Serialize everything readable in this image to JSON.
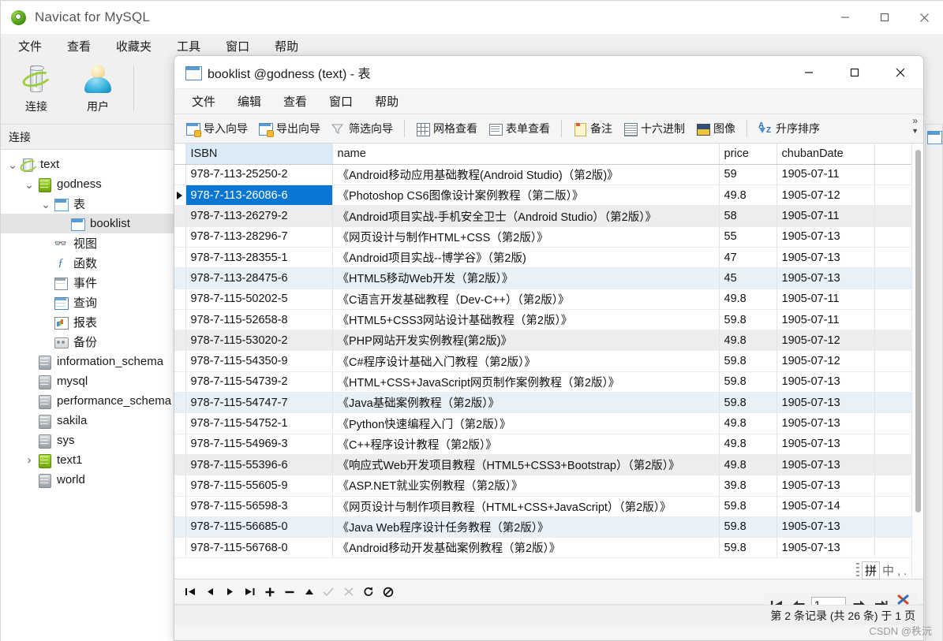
{
  "main_window": {
    "title": "Navicat for MySQL",
    "title_icon": "navicat-logo-icon",
    "menus": [
      "文件",
      "查看",
      "收藏夹",
      "工具",
      "窗口",
      "帮助"
    ],
    "toolbar": [
      {
        "label": "连接",
        "icon": "database-connection-icon"
      },
      {
        "label": "用户",
        "icon": "user-icon"
      }
    ],
    "window_controls": {
      "minimize": "minimize-icon",
      "maximize": "maximize-icon",
      "close": "close-icon"
    },
    "left_panel": {
      "header": "连接",
      "tree": [
        {
          "label": "text",
          "indent": 0,
          "chevron": "down",
          "icon": "connection-icon",
          "selected": false
        },
        {
          "label": "godness",
          "indent": 1,
          "chevron": "down",
          "icon": "database-icon",
          "selected": false
        },
        {
          "label": "表",
          "indent": 2,
          "chevron": "down",
          "icon": "table-folder-icon",
          "selected": false
        },
        {
          "label": "booklist",
          "indent": 3,
          "chevron": "none",
          "icon": "table-icon",
          "selected": true
        },
        {
          "label": "视图",
          "indent": 2,
          "chevron": "none",
          "icon": "view-icon",
          "selected": false
        },
        {
          "label": "函数",
          "indent": 2,
          "chevron": "none",
          "icon": "function-icon",
          "selected": false
        },
        {
          "label": "事件",
          "indent": 2,
          "chevron": "none",
          "icon": "event-icon",
          "selected": false
        },
        {
          "label": "查询",
          "indent": 2,
          "chevron": "none",
          "icon": "query-icon",
          "selected": false
        },
        {
          "label": "报表",
          "indent": 2,
          "chevron": "none",
          "icon": "report-icon",
          "selected": false
        },
        {
          "label": "备份",
          "indent": 2,
          "chevron": "none",
          "icon": "backup-icon",
          "selected": false
        },
        {
          "label": "information_schema",
          "indent": 1,
          "chevron": "none",
          "icon": "database-gray-icon",
          "selected": false
        },
        {
          "label": "mysql",
          "indent": 1,
          "chevron": "none",
          "icon": "database-gray-icon",
          "selected": false
        },
        {
          "label": "performance_schema",
          "indent": 1,
          "chevron": "none",
          "icon": "database-gray-icon",
          "selected": false
        },
        {
          "label": "sakila",
          "indent": 1,
          "chevron": "none",
          "icon": "database-gray-icon",
          "selected": false
        },
        {
          "label": "sys",
          "indent": 1,
          "chevron": "none",
          "icon": "database-gray-icon",
          "selected": false
        },
        {
          "label": "text1",
          "indent": 1,
          "chevron": "right",
          "icon": "database-icon",
          "selected": false
        },
        {
          "label": "world",
          "indent": 1,
          "chevron": "none",
          "icon": "database-gray-icon",
          "selected": false
        }
      ]
    }
  },
  "child_window": {
    "title": "booklist @godness (text) - 表",
    "title_icon": "table-icon",
    "window_controls": {
      "minimize": "minimize-icon",
      "maximize": "maximize-icon",
      "close": "close-icon"
    },
    "menus": [
      "文件",
      "编辑",
      "查看",
      "窗口",
      "帮助"
    ],
    "toolbar": [
      {
        "label": "导入向导",
        "icon": "import-wizard-icon"
      },
      {
        "label": "导出向导",
        "icon": "export-wizard-icon"
      },
      {
        "label": "筛选向导",
        "icon": "filter-wizard-icon"
      },
      {
        "label": "网格查看",
        "icon": "grid-view-icon"
      },
      {
        "label": "表单查看",
        "icon": "form-view-icon"
      },
      {
        "label": "备注",
        "icon": "note-icon"
      },
      {
        "label": "十六进制",
        "icon": "hex-icon"
      },
      {
        "label": "图像",
        "icon": "image-icon"
      },
      {
        "label": "升序排序",
        "icon": "sort-ascending-icon"
      }
    ],
    "toolbar_overflow": "»",
    "nav_buttons": [
      {
        "icon": "first-record-icon",
        "disabled": false
      },
      {
        "icon": "prev-record-icon",
        "disabled": false
      },
      {
        "icon": "next-record-icon",
        "disabled": false
      },
      {
        "icon": "last-record-icon",
        "disabled": false
      },
      {
        "icon": "add-record-icon",
        "disabled": false
      },
      {
        "icon": "delete-record-icon",
        "disabled": false
      },
      {
        "icon": "apply-change-icon",
        "disabled": false
      },
      {
        "icon": "confirm-edit-icon",
        "disabled": true
      },
      {
        "icon": "cancel-edit-icon",
        "disabled": true
      },
      {
        "icon": "refresh-icon",
        "disabled": false
      },
      {
        "icon": "stop-icon",
        "disabled": false
      }
    ],
    "page_nav": {
      "first_icon": "page-first-icon",
      "prev_icon": "page-prev-icon",
      "page_value": "1",
      "next_icon": "page-next-icon",
      "last_icon": "page-last-icon",
      "tools_icon": "tools-icon"
    },
    "status": "第 2 条记录 (共 26 条) 于 1 页"
  },
  "grid": {
    "columns": [
      "ISBN",
      "name",
      "price",
      "chubanDate"
    ],
    "rows": [
      {
        "isbn": "978-7-113-25250-2",
        "name": "《Android移动应用基础教程(Android Studio)（第2版)》",
        "price": "59",
        "date": "1905-07-11",
        "shade": "none",
        "selected": false
      },
      {
        "isbn": "978-7-113-26086-6",
        "name": "《Photoshop CS6图像设计案例教程（第二版）》",
        "price": "49.8",
        "date": "1905-07-12",
        "shade": "none",
        "selected": true
      },
      {
        "isbn": "978-7-113-26279-2",
        "name": "《Android项目实战-手机安全卫士（Android Studio）（第2版）》",
        "price": "58",
        "date": "1905-07-11",
        "shade": "gray",
        "selected": false
      },
      {
        "isbn": "978-7-113-28296-7",
        "name": "《网页设计与制作HTML+CSS（第2版）》",
        "price": "55",
        "date": "1905-07-13",
        "shade": "none",
        "selected": false
      },
      {
        "isbn": "978-7-113-28355-1",
        "name": "《Android项目实战--博学谷》（第2版)",
        "price": "47",
        "date": "1905-07-13",
        "shade": "none",
        "selected": false
      },
      {
        "isbn": "978-7-113-28475-6",
        "name": "《HTML5移动Web开发（第2版）》",
        "price": "45",
        "date": "1905-07-13",
        "shade": "blue",
        "selected": false
      },
      {
        "isbn": "978-7-115-50202-5",
        "name": "《C语言开发基础教程（Dev-C++）（第2版）》",
        "price": "49.8",
        "date": "1905-07-11",
        "shade": "none",
        "selected": false
      },
      {
        "isbn": "978-7-115-52658-8",
        "name": "《HTML5+CSS3网站设计基础教程（第2版）》",
        "price": "59.8",
        "date": "1905-07-11",
        "shade": "none",
        "selected": false
      },
      {
        "isbn": "978-7-115-53020-2",
        "name": "《PHP网站开发实例教程(第2版)》",
        "price": "49.8",
        "date": "1905-07-12",
        "shade": "gray",
        "selected": false
      },
      {
        "isbn": "978-7-115-54350-9",
        "name": "《C#程序设计基础入门教程（第2版）》",
        "price": "59.8",
        "date": "1905-07-12",
        "shade": "none",
        "selected": false
      },
      {
        "isbn": "978-7-115-54739-2",
        "name": "《HTML+CSS+JavaScript网页制作案例教程（第2版）》",
        "price": "59.8",
        "date": "1905-07-13",
        "shade": "none",
        "selected": false
      },
      {
        "isbn": "978-7-115-54747-7",
        "name": "《Java基础案例教程（第2版）》",
        "price": "59.8",
        "date": "1905-07-13",
        "shade": "blue",
        "selected": false
      },
      {
        "isbn": "978-7-115-54752-1",
        "name": "《Python快速编程入门（第2版）》",
        "price": "49.8",
        "date": "1905-07-13",
        "shade": "none",
        "selected": false
      },
      {
        "isbn": "978-7-115-54969-3",
        "name": "《C++程序设计教程（第2版）》",
        "price": "49.8",
        "date": "1905-07-13",
        "shade": "none",
        "selected": false
      },
      {
        "isbn": "978-7-115-55396-6",
        "name": "《响应式Web开发项目教程（HTML5+CSS3+Bootstrap）（第2版）》",
        "price": "49.8",
        "date": "1905-07-13",
        "shade": "gray",
        "selected": false
      },
      {
        "isbn": "978-7-115-55605-9",
        "name": "《ASP.NET就业实例教程（第2版）》",
        "price": "39.8",
        "date": "1905-07-13",
        "shade": "none",
        "selected": false
      },
      {
        "isbn": "978-7-115-56598-3",
        "name": "《网页设计与制作项目教程（HTML+CSS+JavaScript）（第2版）》",
        "price": "59.8",
        "date": "1905-07-14",
        "shade": "none",
        "selected": false
      },
      {
        "isbn": "978-7-115-56685-0",
        "name": "《Java Web程序设计任务教程（第2版）》",
        "price": "59.8",
        "date": "1905-07-13",
        "shade": "blue",
        "selected": false
      },
      {
        "isbn": "978-7-115-56768-0",
        "name": "《Android移动开发基础案例教程（第2版）》",
        "price": "59.8",
        "date": "1905-07-13",
        "shade": "none",
        "selected": false
      }
    ]
  },
  "overlays": {
    "ime_label": "拼",
    "ime_rest": "中,.",
    "watermark": "CSDN @秩沅"
  },
  "colors": {
    "selection_blue": "#0a76d4",
    "header_isbn_bg": "#dbeaf7",
    "row_alt_gray": "#ededed",
    "row_alt_blue": "#e8f0f8",
    "tree_selected": "#e4e4e4"
  }
}
